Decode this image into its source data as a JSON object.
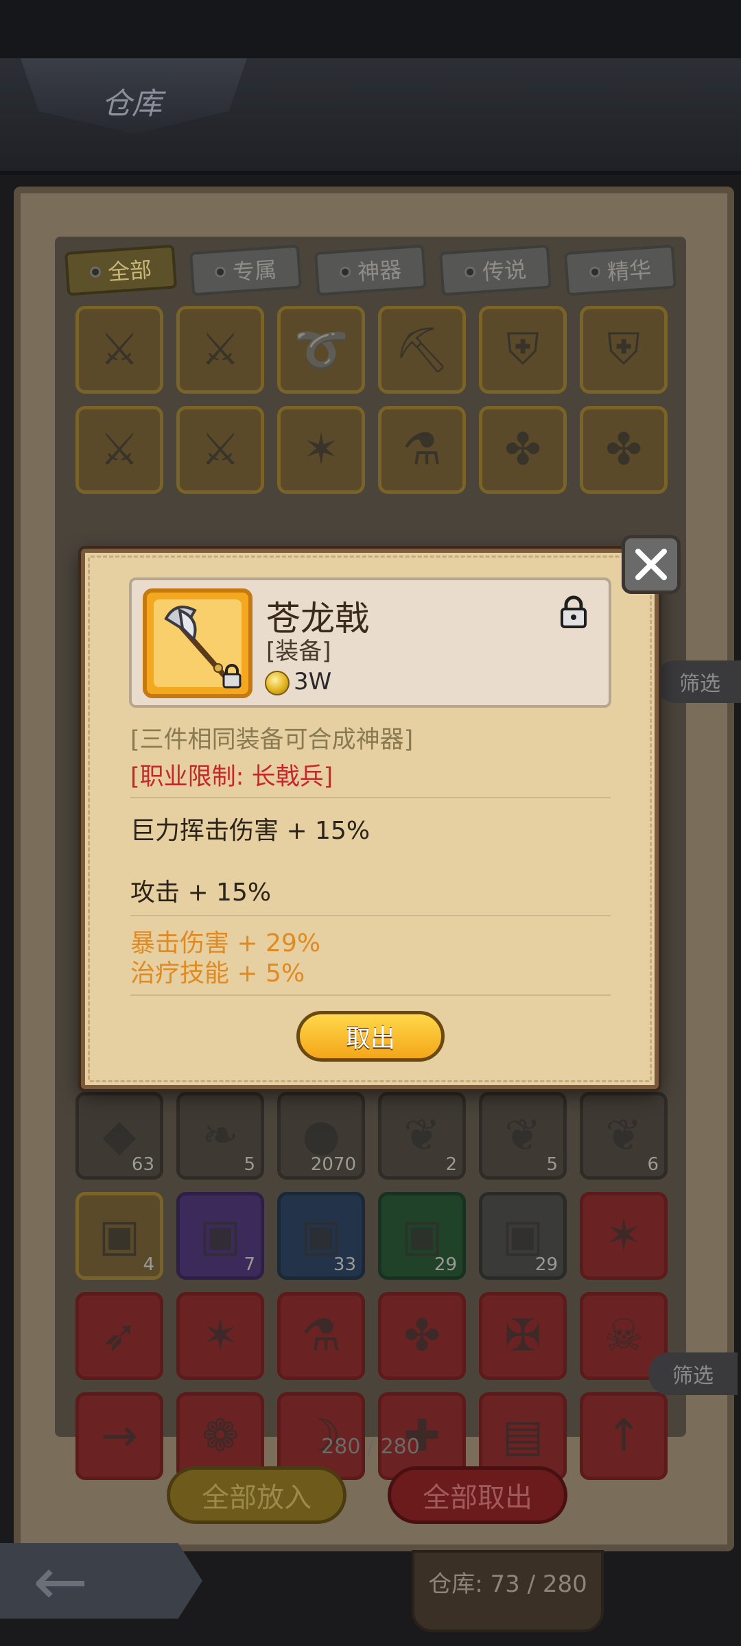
{
  "screen": {
    "title": "仓库"
  },
  "tabs": [
    {
      "label": "全部",
      "active": true
    },
    {
      "label": "专属",
      "active": false
    },
    {
      "label": "神器",
      "active": false
    },
    {
      "label": "传说",
      "active": false
    },
    {
      "label": "精华",
      "active": false
    }
  ],
  "warehouse": {
    "filter_label": "筛选",
    "rows": [
      [
        {
          "icon": "sword-icon",
          "tier": "gold"
        },
        {
          "icon": "sword-icon",
          "tier": "gold"
        },
        {
          "icon": "whip-icon",
          "tier": "gold"
        },
        {
          "icon": "pickaxe-icon",
          "tier": "gold"
        },
        {
          "icon": "shield-icon",
          "tier": "gold"
        },
        {
          "icon": "shield-icon",
          "tier": "gold"
        }
      ],
      [
        {
          "icon": "crossed-swords-icon",
          "tier": "gold"
        },
        {
          "icon": "crossed-swords-icon",
          "tier": "gold"
        },
        {
          "icon": "crossbow-icon",
          "tier": "gold"
        },
        {
          "icon": "potion-icon",
          "tier": "gold"
        },
        {
          "icon": "staff-icon",
          "tier": "gold"
        },
        {
          "icon": "staff-icon",
          "tier": "gold"
        }
      ]
    ]
  },
  "inventory": {
    "filter_label": "筛选",
    "rows": [
      [
        {
          "icon": "rune-icon",
          "count": "63",
          "tier": "dark"
        },
        {
          "icon": "feather-icon",
          "count": "5",
          "tier": "dark"
        },
        {
          "icon": "orb-icon",
          "count": "2070",
          "tier": "dark"
        },
        {
          "icon": "leaf-icon",
          "count": "2",
          "tier": "dark"
        },
        {
          "icon": "leaf-icon",
          "count": "5",
          "tier": "dark"
        },
        {
          "icon": "leaf-icon",
          "count": "6",
          "tier": "dark"
        }
      ],
      [
        {
          "icon": "chest-icon",
          "count": "4",
          "tier": "gold"
        },
        {
          "icon": "chest-icon",
          "count": "7",
          "tier": "purple"
        },
        {
          "icon": "chest-icon",
          "count": "33",
          "tier": "blue"
        },
        {
          "icon": "chest-icon",
          "count": "29",
          "tier": "green"
        },
        {
          "icon": "chest-icon",
          "count": "29",
          "tier": "gray"
        },
        {
          "icon": "crossbow-icon",
          "count": "",
          "tier": "red"
        }
      ],
      [
        {
          "icon": "bow-icon",
          "count": "",
          "tier": "red"
        },
        {
          "icon": "crossbow-icon",
          "count": "",
          "tier": "red"
        },
        {
          "icon": "potion-icon",
          "count": "",
          "tier": "red"
        },
        {
          "icon": "staff-icon",
          "count": "",
          "tier": "red"
        },
        {
          "icon": "halberd-icon",
          "count": "",
          "tier": "red"
        },
        {
          "icon": "skull-icon",
          "count": "",
          "tier": "red"
        }
      ],
      [
        {
          "icon": "gun-icon",
          "count": "",
          "tier": "red"
        },
        {
          "icon": "wing-icon",
          "count": "",
          "tier": "red"
        },
        {
          "icon": "horn-icon",
          "count": "",
          "tier": "red"
        },
        {
          "icon": "medkit-icon",
          "count": "",
          "tier": "red"
        },
        {
          "icon": "book-icon",
          "count": "",
          "tier": "red"
        },
        {
          "icon": "spear-icon",
          "count": "",
          "tier": "red"
        }
      ]
    ],
    "capacity_text": "280 / 280",
    "put_all_label": "全部放入",
    "take_all_label": "全部取出"
  },
  "footer": {
    "warehouse_capacity": "仓库: 73 / 280"
  },
  "popup": {
    "item_name": "苍龙戟",
    "item_type": "[装备]",
    "price": "3W",
    "item_icon": "halberd-icon",
    "locked": true,
    "description": "[三件相同装备可合成神器]",
    "class_limit": "[职业限制: 长戟兵]",
    "stats": [
      {
        "text": "巨力挥击伤害 + 15%",
        "color": "default"
      },
      {
        "text": "攻击 + 15%",
        "color": "default"
      },
      {
        "text": "暴击伤害 + 29%",
        "color": "orange"
      },
      {
        "text": "治疗技能 + 5%",
        "color": "orange"
      }
    ],
    "take_out_label": "取出"
  },
  "colors": {
    "accent_gold": "#f4a61a",
    "limit_red": "#c8262a",
    "bonus_orange": "#e08a22",
    "parchment": "#e6cfa0"
  }
}
